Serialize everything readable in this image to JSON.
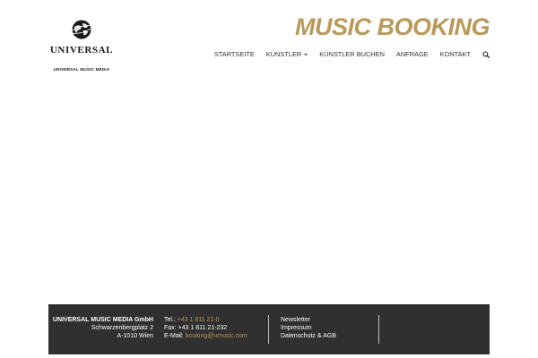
{
  "header": {
    "logo": {
      "wordmark": "UNIVERSAL",
      "subline": "UNIVERSAL MUSIC MEDIA",
      "icon": "globe-icon"
    },
    "title": "MUSIC BOOKING"
  },
  "nav": {
    "items": [
      {
        "label": "STARTSEITE"
      },
      {
        "label": "KÜNSTLER",
        "has_dropdown": true
      },
      {
        "label": "KÜNSTLER BUCHEN"
      },
      {
        "label": "ANFRAGE"
      },
      {
        "label": "KONTAKT"
      }
    ],
    "search_icon": "search-icon"
  },
  "footer": {
    "address": {
      "company": "UNIVERSAL MUSIC MEDIA GmbH",
      "street": "Schwarzenbergplatz 2",
      "city": "A-1010 Wien"
    },
    "contact": {
      "tel_label": "Tel.: ",
      "tel_value": "+43 1 811 21-0",
      "fax_label": "Fax: ",
      "fax_value": "+43 1 811 21-232",
      "email_label": "E-Mail: ",
      "email_value": "booking@umusic.com"
    },
    "links": [
      {
        "label": "Newsletter"
      },
      {
        "label": "Impressum"
      },
      {
        "label": "Datenschutz & AGB"
      }
    ]
  },
  "colors": {
    "accent": "#b89a5c",
    "footer_bg": "#303030",
    "text": "#333333"
  }
}
